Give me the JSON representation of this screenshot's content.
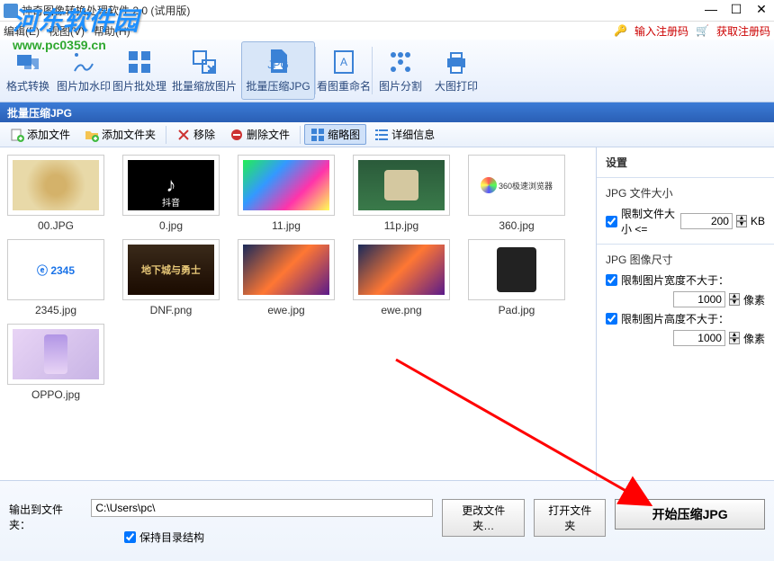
{
  "window": {
    "title": "神奇图像转换处理软件 2.0 (试用版)"
  },
  "menu": {
    "edit": "编辑(E)",
    "view": "视图(V)",
    "help": "帮助(H)"
  },
  "reg": {
    "enter_code": "输入注册码",
    "get_code": "获取注册码"
  },
  "watermark": {
    "logo": "河东软件园",
    "url": "www.pc0359.cn"
  },
  "toolbar": {
    "format": "格式转换",
    "watermark": "图片加水印",
    "batch": "图片批处理",
    "resize": "批量缩放图片",
    "compress": "批量压缩JPG",
    "rename": "看图重命名",
    "split": "图片分割",
    "print": "大图打印"
  },
  "section_title": "批量压缩JPG",
  "subbar": {
    "add_file": "添加文件",
    "add_folder": "添加文件夹",
    "remove": "移除",
    "delete": "删除文件",
    "thumbs": "缩略图",
    "detail": "详细信息"
  },
  "files": [
    {
      "name": "00.JPG",
      "cls": "pic-00"
    },
    {
      "name": "0.jpg",
      "cls": "pic-0"
    },
    {
      "name": "11.jpg",
      "cls": "pic-11"
    },
    {
      "name": "11p.jpg",
      "cls": "pic-11p"
    },
    {
      "name": "360.jpg",
      "cls": "pic-360"
    },
    {
      "name": "2345.jpg",
      "cls": "pic-2345"
    },
    {
      "name": "DNF.png",
      "cls": "pic-dnf"
    },
    {
      "name": "ewe.jpg",
      "cls": "pic-ewe"
    },
    {
      "name": "ewe.png",
      "cls": "pic-ewe"
    },
    {
      "name": "Pad.jpg",
      "cls": "pic-pad"
    },
    {
      "name": "OPPO.jpg",
      "cls": "pic-oppo"
    }
  ],
  "settings": {
    "heading": "设置",
    "size_title": "JPG 文件大小",
    "limit_size_label": "限制文件大小 <=",
    "limit_size_value": "200",
    "kb": "KB",
    "dim_title": "JPG 图像尺寸",
    "limit_w_label": "限制图片宽度不大于：",
    "limit_w_value": "1000",
    "limit_h_label": "限制图片高度不大于：",
    "limit_h_value": "1000",
    "px": "像素"
  },
  "output": {
    "label": "输出到文件夹：",
    "path": "C:\\Users\\pc\\",
    "change": "更改文件夹…",
    "open": "打开文件夹",
    "keep": "保持目录结构",
    "start": "开始压缩JPG"
  },
  "thumb_extra": {
    "douyin": "抖音",
    "dnf": "地下城与勇士",
    "browser360": "360极速浏览器",
    "ie2345": "ⓔ 2345"
  }
}
